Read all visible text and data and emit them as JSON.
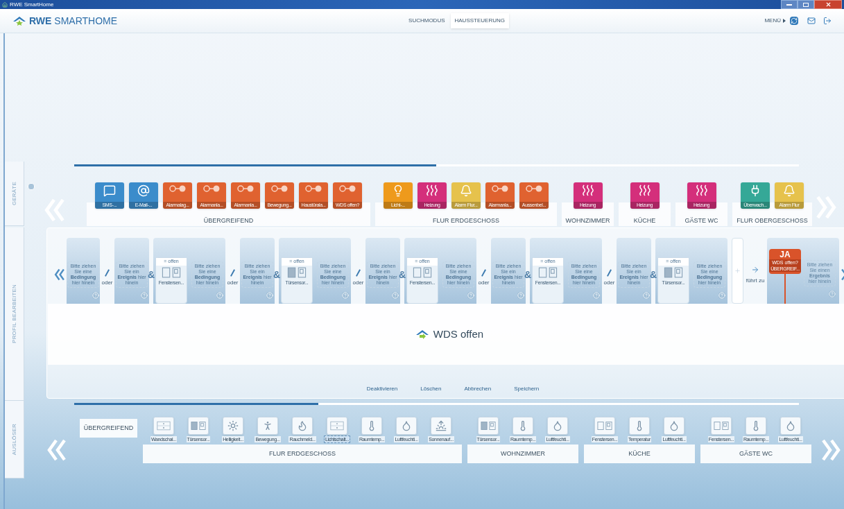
{
  "window": {
    "title": "RWE SmartHome"
  },
  "header": {
    "logo_bold": "RWE",
    "logo_text": "SMARTHOME",
    "tabs": [
      {
        "label": "SUCHMODUS",
        "selected": false
      },
      {
        "label": "HAUSSTEUERUNG",
        "selected": true
      }
    ],
    "menu": "MENÜ"
  },
  "devices": {
    "label": "GERÄTE",
    "groups": [
      {
        "name": "ÜBERGREIFEND",
        "items": [
          {
            "label": "SMS-...",
            "kind": "sms"
          },
          {
            "label": "E-Mail-...",
            "kind": "email"
          },
          {
            "label": "Alarmalag...",
            "kind": "alarm"
          },
          {
            "label": "Alarmanla...",
            "kind": "alarm"
          },
          {
            "label": "Alarmanla...",
            "kind": "alarm"
          },
          {
            "label": "Bewegung...",
            "kind": "alarm"
          },
          {
            "label": "Haustürala...",
            "kind": "alarm"
          },
          {
            "label": "WDS offen?",
            "kind": "alarm"
          }
        ]
      },
      {
        "name": "FLUR ERDGESCHOSS",
        "items": [
          {
            "label": "Licht-...",
            "kind": "light"
          },
          {
            "label": "Heizung",
            "kind": "heating"
          },
          {
            "label": "Alarm Flur...",
            "kind": "bell"
          },
          {
            "label": "Alarmanla...",
            "kind": "alarm"
          },
          {
            "label": "Aussenbel...",
            "kind": "alarm"
          }
        ]
      },
      {
        "name": "WOHNZIMMER",
        "items": [
          {
            "label": "Heizung",
            "kind": "heating"
          }
        ]
      },
      {
        "name": "KÜCHE",
        "items": [
          {
            "label": "Heizung",
            "kind": "heating"
          }
        ]
      },
      {
        "name": "GÄSTE WC",
        "items": [
          {
            "label": "Heizung",
            "kind": "heating"
          }
        ]
      },
      {
        "name": "FLUR OBERGESCHOSS",
        "items": [
          {
            "label": "Überwach...",
            "kind": "monitor"
          },
          {
            "label": "Alarm Flur",
            "kind": "bell"
          }
        ]
      }
    ]
  },
  "profile": {
    "label": "PROFIL BEARBEITEN",
    "rules": [
      {
        "kind": "condition",
        "text": "Bitte ziehen Sie eine **Bedingung** hier hinein"
      },
      {
        "kind": "or",
        "text": "oder"
      },
      {
        "kind": "group",
        "event": "Bitte ziehen Sie ein **Ereignis** hier hinein",
        "and": "&",
        "sensor": {
          "state": "= offen",
          "label": "Fenstersen...",
          "kind": "window"
        },
        "condition": "Bitte ziehen Sie eine **Bedingung** hier hinein"
      },
      {
        "kind": "or",
        "text": "oder"
      },
      {
        "kind": "group",
        "event": "Bitte ziehen Sie ein **Ereignis** hier hinein",
        "and": "&",
        "sensor": {
          "state": "= offen",
          "label": "Türsensor...",
          "kind": "door"
        },
        "condition": "Bitte ziehen Sie eine **Bedingung** hier hinein"
      },
      {
        "kind": "or",
        "text": "oder"
      },
      {
        "kind": "group",
        "event": "Bitte ziehen Sie ein **Ereignis** hier hinein",
        "and": "&",
        "sensor": {
          "state": "= offen",
          "label": "Fenstersen...",
          "kind": "window"
        },
        "condition": "Bitte ziehen Sie eine **Bedingung** hier hinein"
      },
      {
        "kind": "or",
        "text": "oder"
      },
      {
        "kind": "group",
        "event": "Bitte ziehen Sie ein **Ereignis** hier hinein",
        "and": "&",
        "sensor": {
          "state": "= offen",
          "label": "Fenstersen...",
          "kind": "window"
        },
        "condition": "Bitte ziehen Sie eine **Bedingung** hier hinein"
      },
      {
        "kind": "or",
        "text": "oder"
      },
      {
        "kind": "group",
        "event": "Bitte ziehen Sie ein **Ereignis** hier hinein",
        "and": "&",
        "sensor": {
          "state": "= offen",
          "label": "Türsensor...",
          "kind": "door"
        },
        "condition": "Bitte ziehen Sie eine **Bedingung** hier hinein"
      },
      {
        "kind": "add"
      },
      {
        "kind": "leads_to",
        "text": "führt zu"
      },
      {
        "kind": "result",
        "badge": "JA",
        "device": "WDS offen?",
        "group": "ÜBERGREIF...",
        "slot": "Bitte ziehen Sie einen **Ergebnis** hier hinein"
      }
    ],
    "title": "WDS offen",
    "actions": [
      "Deaktivieren",
      "Löschen",
      "Abbrechen",
      "Speichern"
    ]
  },
  "triggers": {
    "label": "AUSLÖSER",
    "groups": [
      {
        "name": "ÜBERGREIFEND"
      },
      {
        "name": "FLUR ERDGESCHOSS",
        "items": [
          {
            "label": "Wandschal...",
            "kind": "switch",
            "selected": false
          },
          {
            "label": "Türsensor...",
            "kind": "door",
            "selected": false
          },
          {
            "label": "Helligkeit...",
            "kind": "brightness",
            "selected": false
          },
          {
            "label": "Bewegung...",
            "kind": "motion",
            "selected": false
          },
          {
            "label": "Rauchmeld...",
            "kind": "smoke",
            "selected": false
          },
          {
            "label": "Lichtschalt...",
            "kind": "switch",
            "selected": true
          },
          {
            "label": "Raumtemp...",
            "kind": "temperature",
            "selected": false
          },
          {
            "label": "Luftfeuchti...",
            "kind": "humidity",
            "selected": false
          },
          {
            "label": "Sonnenauf...",
            "kind": "sunrise",
            "selected": false
          }
        ]
      },
      {
        "name": "WOHNZIMMER",
        "items": [
          {
            "label": "Türsensor...",
            "kind": "door",
            "selected": false
          },
          {
            "label": "Raumtemp...",
            "kind": "temperature",
            "selected": false
          },
          {
            "label": "Luftfeuchti...",
            "kind": "humidity",
            "selected": false
          }
        ]
      },
      {
        "name": "KÜCHE",
        "items": [
          {
            "label": "Fenstersen...",
            "kind": "window",
            "selected": false
          },
          {
            "label": "Temperatur",
            "kind": "temperature",
            "selected": false
          },
          {
            "label": "Luftfeuchti...",
            "kind": "humidity",
            "selected": false
          }
        ]
      },
      {
        "name": "GÄSTE WC",
        "items": [
          {
            "label": "Fenstersen...",
            "kind": "window",
            "selected": false
          },
          {
            "label": "Raumtemp...",
            "kind": "temperature",
            "selected": false
          },
          {
            "label": "Luftfeuchti...",
            "kind": "humidity",
            "selected": false
          }
        ]
      }
    ]
  }
}
